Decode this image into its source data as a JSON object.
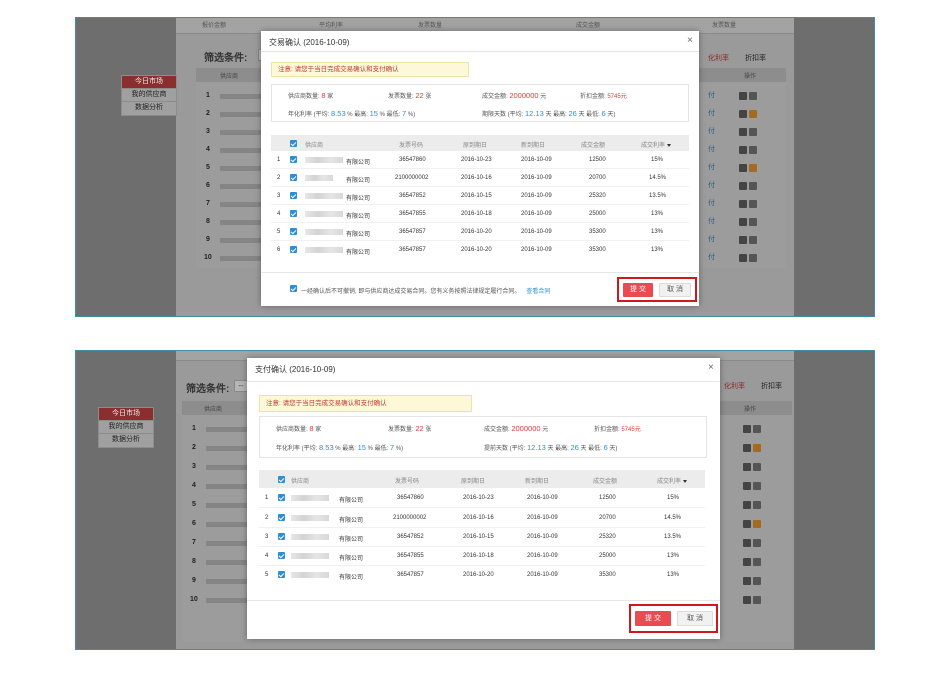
{
  "background": {
    "stats_labels": [
      "报价金额",
      "平均利率",
      "发票数量",
      "成交金额",
      "发票数量"
    ],
    "filter_label": "筛选条件:",
    "filter_box": "--",
    "table_header": {
      "supplier": "供应商",
      "ops": "操作"
    },
    "right_tabs": {
      "a": "化利率",
      "b": "折扣率"
    },
    "row_link": "付",
    "side_nav": [
      "今日市场",
      "我的供应商",
      "数据分析"
    ],
    "row_numbers": [
      "1",
      "2",
      "3",
      "4",
      "5",
      "6",
      "7",
      "8",
      "9",
      "10"
    ]
  },
  "modal1": {
    "title": "交易确认 (2016-10-09)",
    "close": "×",
    "notice": "注意: 请您于当日完成交易确认和支付确认",
    "summary": {
      "supplier_count_label": "供应商数量:",
      "supplier_count": "8",
      "supplier_unit": "家",
      "invoice_count_label": "发票数量:",
      "invoice_count": "22",
      "invoice_unit": "张",
      "deal_amount_label": "成交金额:",
      "deal_amount": "2000000",
      "deal_unit": "元",
      "discount_label": "折扣金额:",
      "discount": "5745元",
      "rate_label": "年化利率 (平均:",
      "rate_avg": "8.53",
      "rate_max_label": "% 最高:",
      "rate_max": "15",
      "rate_min_label": "% 最低:",
      "rate_min": "7",
      "rate_end": "%)",
      "days_label": "期限天数 (平均:",
      "days_avg": "12.13",
      "days_max_label": "天 最高:",
      "days_max": "26",
      "days_min_label": "天 最低:",
      "days_min": "6",
      "days_end": "天)"
    },
    "columns": [
      "供应商",
      "发票号码",
      "原到期日",
      "新到期日",
      "成交金额",
      "成交利率"
    ],
    "rows": [
      {
        "idx": "1",
        "company": "有限公司",
        "invoice": "36547860",
        "orig": "2016-10-23",
        "new": "2016-10-09",
        "amount": "12500",
        "rate": "15%"
      },
      {
        "idx": "2",
        "company": "有限公司",
        "invoice": "2100000002",
        "orig": "2016-10-16",
        "new": "2016-10-09",
        "amount": "20700",
        "rate": "14.5%"
      },
      {
        "idx": "3",
        "company": "有限公司",
        "invoice": "36547852",
        "orig": "2016-10-15",
        "new": "2016-10-09",
        "amount": "25320",
        "rate": "13.5%"
      },
      {
        "idx": "4",
        "company": "有限公司",
        "invoice": "36547855",
        "orig": "2016-10-18",
        "new": "2016-10-09",
        "amount": "25000",
        "rate": "13%"
      },
      {
        "idx": "5",
        "company": "有限公司",
        "invoice": "36547857",
        "orig": "2016-10-20",
        "new": "2016-10-09",
        "amount": "35300",
        "rate": "13%"
      },
      {
        "idx": "6",
        "company": "有限公司",
        "invoice": "36547857",
        "orig": "2016-10-20",
        "new": "2016-10-09",
        "amount": "35300",
        "rate": "13%"
      }
    ],
    "agreement": "一经确认后不可撤销, 即与供应商达成交易合同。您有义务按照法律规定履行合同。",
    "view_contract": "查看合同",
    "submit": "提 交",
    "cancel": "取 消"
  },
  "modal2": {
    "title": "支付确认 (2016-10-09)",
    "close": "×",
    "notice": "注意: 请您于当日完成交易确认和支付确认",
    "summary": {
      "supplier_count_label": "供应商数量:",
      "supplier_count": "8",
      "supplier_unit": "家",
      "invoice_count_label": "发票数量:",
      "invoice_count": "22",
      "invoice_unit": "张",
      "deal_amount_label": "成交金额:",
      "deal_amount": "2000000",
      "deal_unit": "元",
      "discount_label": "折扣金额:",
      "discount": "5745元",
      "rate_label": "年化利率 (平均:",
      "rate_avg": "8.53",
      "rate_max_label": "% 最高:",
      "rate_max": "15",
      "rate_min_label": "% 最低:",
      "rate_min": "7",
      "rate_end": "%)",
      "days_label": "提前天数 (平均:",
      "days_avg": "12.13",
      "days_max_label": "天 最高:",
      "days_max": "26",
      "days_min_label": "天 最低:",
      "days_min": "6",
      "days_end": "天)"
    },
    "columns": [
      "供应商",
      "发票号码",
      "原到期日",
      "新到期日",
      "成交金额",
      "成交利率"
    ],
    "rows": [
      {
        "idx": "1",
        "company": "有限公司",
        "invoice": "36547860",
        "orig": "2016-10-23",
        "new": "2016-10-09",
        "amount": "12500",
        "rate": "15%"
      },
      {
        "idx": "2",
        "company": "有限公司",
        "invoice": "2100000002",
        "orig": "2016-10-16",
        "new": "2016-10-09",
        "amount": "20700",
        "rate": "14.5%"
      },
      {
        "idx": "3",
        "company": "有限公司",
        "invoice": "36547852",
        "orig": "2016-10-15",
        "new": "2016-10-09",
        "amount": "25320",
        "rate": "13.5%"
      },
      {
        "idx": "4",
        "company": "有限公司",
        "invoice": "36547855",
        "orig": "2016-10-18",
        "new": "2016-10-09",
        "amount": "25000",
        "rate": "13%"
      },
      {
        "idx": "5",
        "company": "有限公司",
        "invoice": "36547857",
        "orig": "2016-10-20",
        "new": "2016-10-09",
        "amount": "35300",
        "rate": "13%"
      }
    ],
    "submit": "提 交",
    "cancel": "取 消"
  },
  "colors": {
    "accent_red": "#e2393b",
    "accent_blue": "#2c8fd6",
    "highlight": "#d0171b",
    "panel_border": "#3f8fa3"
  }
}
